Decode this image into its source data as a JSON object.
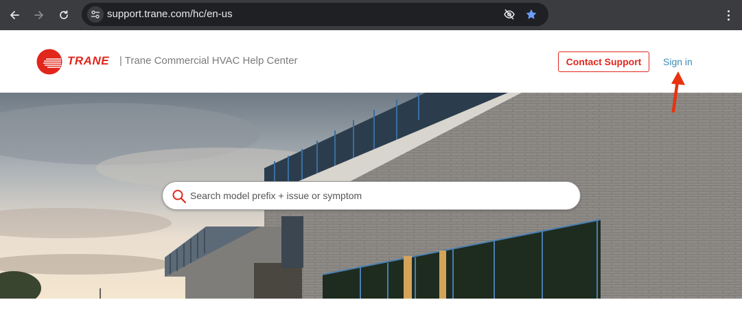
{
  "browser": {
    "url": "support.trane.com/hc/en-us",
    "back_icon": "arrow-left-icon",
    "forward_icon": "arrow-right-icon",
    "reload_icon": "reload-icon",
    "site_info_icon": "tune-icon",
    "eye_off_icon": "eye-off-icon",
    "bookmark_icon": "star-icon",
    "menu_icon": "kebab-menu-icon"
  },
  "header": {
    "brand": "TRANE",
    "title": "| Trane Commercial HVAC Help Center",
    "contact_label": "Contact Support",
    "signin_label": "Sign in"
  },
  "hero": {
    "search_placeholder": "Search model prefix + issue or symptom"
  },
  "colors": {
    "brand_red": "#e1261c",
    "link_blue": "#3a8bb5",
    "chrome_bg": "#3b3c3f"
  }
}
